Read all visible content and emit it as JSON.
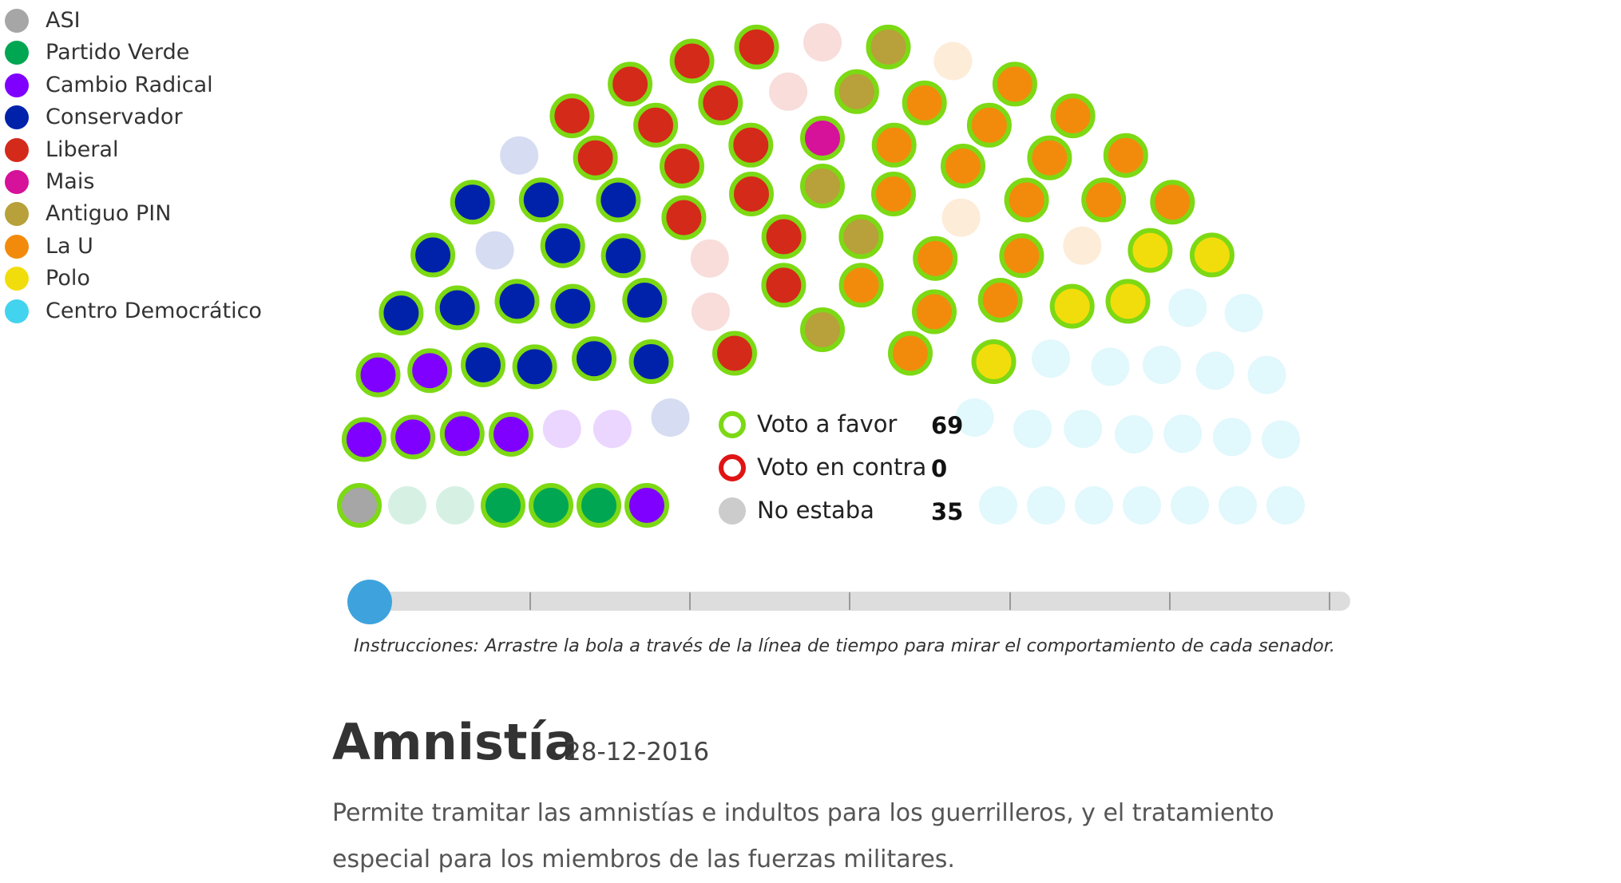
{
  "legend": [
    {
      "label": "ASI",
      "color": "#a6a6a6"
    },
    {
      "label": "Partido Verde",
      "color": "#00a651"
    },
    {
      "label": "Cambio Radical",
      "color": "#8000ff"
    },
    {
      "label": "Conservador",
      "color": "#0022aa"
    },
    {
      "label": "Liberal",
      "color": "#d42a1a"
    },
    {
      "label": "Mais",
      "color": "#d6119a"
    },
    {
      "label": "Antiguo PIN",
      "color": "#b8a03a"
    },
    {
      "label": "La U",
      "color": "#f28b0c"
    },
    {
      "label": "Polo",
      "color": "#f2dd0c"
    },
    {
      "label": "Centro Democrático",
      "color": "#42d3ee"
    }
  ],
  "vote_key": [
    {
      "label": "Voto a favor",
      "count": "69",
      "mark": "favor",
      "color": "#7cd914"
    },
    {
      "label": "Voto en contra",
      "count": "0",
      "mark": "contra",
      "color": "#e01414"
    },
    {
      "label": "No estaba",
      "count": "35",
      "mark": "ausente",
      "color": "#cccccc"
    }
  ],
  "chamber": {
    "favor_ring_color": "#7cd914",
    "seats": [
      {
        "party": 0,
        "vote": "favor"
      },
      {
        "party": 1,
        "vote": "ausente"
      },
      {
        "party": 1,
        "vote": "ausente"
      },
      {
        "party": 1,
        "vote": "favor"
      },
      {
        "party": 1,
        "vote": "favor"
      },
      {
        "party": 1,
        "vote": "favor"
      },
      {
        "party": 2,
        "vote": "favor"
      },
      {
        "party": 2,
        "vote": "favor"
      },
      {
        "party": 2,
        "vote": "favor"
      },
      {
        "party": 2,
        "vote": "favor"
      },
      {
        "party": 2,
        "vote": "favor"
      },
      {
        "party": 2,
        "vote": "favor"
      },
      {
        "party": 2,
        "vote": "ausente"
      },
      {
        "party": 2,
        "vote": "favor"
      },
      {
        "party": 2,
        "vote": "ausente"
      },
      {
        "party": 3,
        "vote": "favor"
      },
      {
        "party": 3,
        "vote": "favor"
      },
      {
        "party": 3,
        "vote": "favor"
      },
      {
        "party": 3,
        "vote": "favor"
      },
      {
        "party": 3,
        "vote": "ausente"
      },
      {
        "party": 3,
        "vote": "favor"
      },
      {
        "party": 3,
        "vote": "favor"
      },
      {
        "party": 3,
        "vote": "favor"
      },
      {
        "party": 3,
        "vote": "ausente"
      },
      {
        "party": 3,
        "vote": "favor"
      },
      {
        "party": 3,
        "vote": "favor"
      },
      {
        "party": 3,
        "vote": "favor"
      },
      {
        "party": 3,
        "vote": "favor"
      },
      {
        "party": 3,
        "vote": "favor"
      },
      {
        "party": 3,
        "vote": "ausente"
      },
      {
        "party": 3,
        "vote": "favor"
      },
      {
        "party": 3,
        "vote": "favor"
      },
      {
        "party": 3,
        "vote": "favor"
      },
      {
        "party": 4,
        "vote": "favor"
      },
      {
        "party": 4,
        "vote": "favor"
      },
      {
        "party": 4,
        "vote": "ausente"
      },
      {
        "party": 4,
        "vote": "favor"
      },
      {
        "party": 4,
        "vote": "favor"
      },
      {
        "party": 4,
        "vote": "favor"
      },
      {
        "party": 4,
        "vote": "ausente"
      },
      {
        "party": 4,
        "vote": "favor"
      },
      {
        "party": 4,
        "vote": "favor"
      },
      {
        "party": 4,
        "vote": "favor"
      },
      {
        "party": 4,
        "vote": "favor"
      },
      {
        "party": 4,
        "vote": "favor"
      },
      {
        "party": 4,
        "vote": "favor"
      },
      {
        "party": 4,
        "vote": "favor"
      },
      {
        "party": 4,
        "vote": "favor"
      },
      {
        "party": 4,
        "vote": "favor"
      },
      {
        "party": 4,
        "vote": "ausente"
      },
      {
        "party": 4,
        "vote": "ausente"
      },
      {
        "party": 5,
        "vote": "favor"
      },
      {
        "party": 6,
        "vote": "favor"
      },
      {
        "party": 6,
        "vote": "favor"
      },
      {
        "party": 6,
        "vote": "favor"
      },
      {
        "party": 6,
        "vote": "favor"
      },
      {
        "party": 6,
        "vote": "favor"
      },
      {
        "party": 7,
        "vote": "favor"
      },
      {
        "party": 7,
        "vote": "favor"
      },
      {
        "party": 7,
        "vote": "favor"
      },
      {
        "party": 7,
        "vote": "favor"
      },
      {
        "party": 7,
        "vote": "ausente"
      },
      {
        "party": 7,
        "vote": "favor"
      },
      {
        "party": 7,
        "vote": "favor"
      },
      {
        "party": 7,
        "vote": "favor"
      },
      {
        "party": 7,
        "vote": "favor"
      },
      {
        "party": 7,
        "vote": "ausente"
      },
      {
        "party": 7,
        "vote": "favor"
      },
      {
        "party": 7,
        "vote": "favor"
      },
      {
        "party": 7,
        "vote": "favor"
      },
      {
        "party": 7,
        "vote": "favor"
      },
      {
        "party": 7,
        "vote": "favor"
      },
      {
        "party": 7,
        "vote": "favor"
      },
      {
        "party": 7,
        "vote": "favor"
      },
      {
        "party": 7,
        "vote": "favor"
      },
      {
        "party": 7,
        "vote": "favor"
      },
      {
        "party": 7,
        "vote": "ausente"
      },
      {
        "party": 7,
        "vote": "favor"
      },
      {
        "party": 8,
        "vote": "favor"
      },
      {
        "party": 8,
        "vote": "favor"
      },
      {
        "party": 8,
        "vote": "favor"
      },
      {
        "party": 8,
        "vote": "favor"
      },
      {
        "party": 8,
        "vote": "favor"
      },
      {
        "party": 9,
        "vote": "ausente"
      },
      {
        "party": 9,
        "vote": "ausente"
      },
      {
        "party": 9,
        "vote": "ausente"
      },
      {
        "party": 9,
        "vote": "ausente"
      },
      {
        "party": 9,
        "vote": "ausente"
      },
      {
        "party": 9,
        "vote": "ausente"
      },
      {
        "party": 9,
        "vote": "ausente"
      },
      {
        "party": 9,
        "vote": "ausente"
      },
      {
        "party": 9,
        "vote": "ausente"
      },
      {
        "party": 9,
        "vote": "ausente"
      },
      {
        "party": 9,
        "vote": "ausente"
      },
      {
        "party": 9,
        "vote": "ausente"
      },
      {
        "party": 9,
        "vote": "ausente"
      },
      {
        "party": 9,
        "vote": "ausente"
      },
      {
        "party": 9,
        "vote": "ausente"
      },
      {
        "party": 9,
        "vote": "ausente"
      },
      {
        "party": 9,
        "vote": "ausente"
      },
      {
        "party": 9,
        "vote": "ausente"
      },
      {
        "party": 9,
        "vote": "ausente"
      },
      {
        "party": 9,
        "vote": "ausente"
      },
      {
        "party": 9,
        "vote": "ausente"
      },
      {
        "party": 9,
        "vote": "ausente"
      }
    ]
  },
  "timeline": {
    "position": 0
  },
  "instructions": "Instrucciones: Arrastre la bola a través de la línea de tiempo para mirar el comportamiento de cada senador.",
  "article": {
    "title": "Amnistía",
    "date": "28-12-2016",
    "description": "Permite tramitar las amnistías e indultos para los guerrilleros, y el tratamiento especial para los miembros de las fuerzas militares."
  }
}
